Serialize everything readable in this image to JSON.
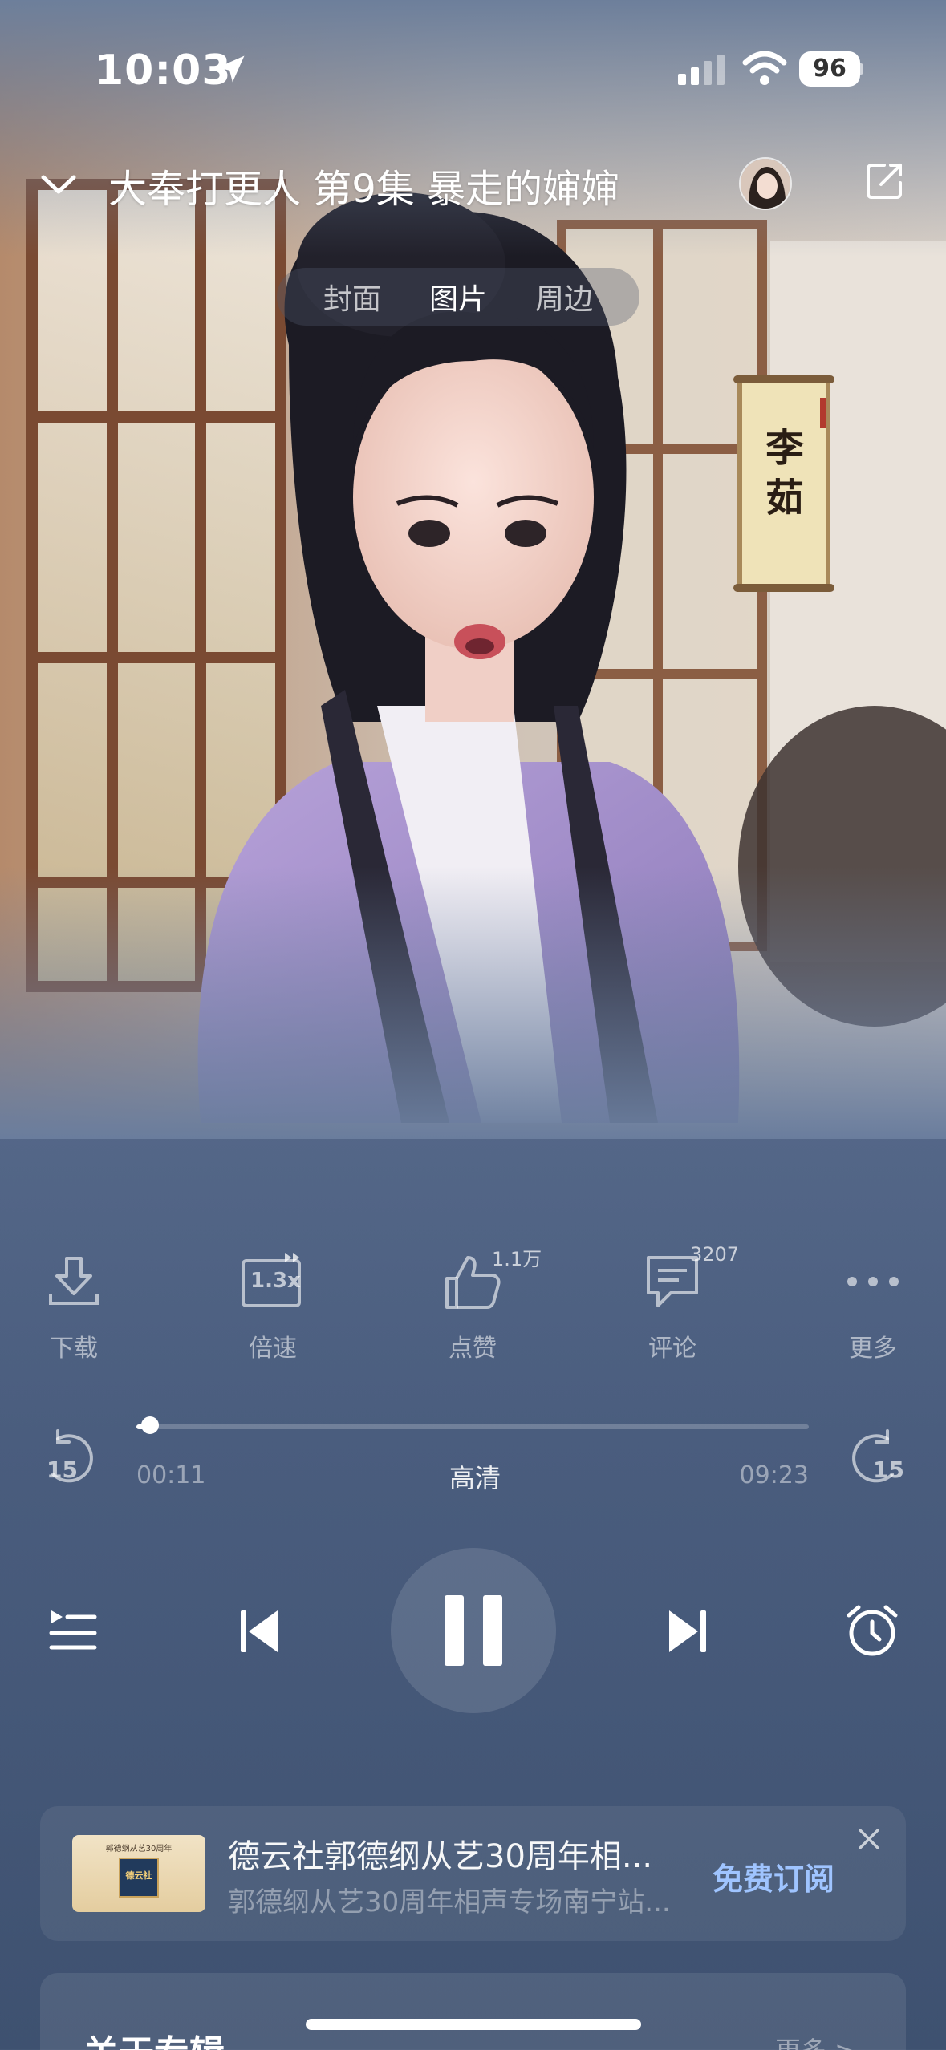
{
  "status_bar": {
    "time": "10:03",
    "battery": "96",
    "icons": [
      "location-arrow-icon",
      "signal-icon",
      "wifi-icon",
      "battery-icon"
    ]
  },
  "header": {
    "title": "大奉打更人 第9集 暴走的婶婶",
    "icons": [
      "chevron-down-icon",
      "avatar",
      "share-icon"
    ]
  },
  "tabs": [
    {
      "label": "封面",
      "active": false
    },
    {
      "label": "图片",
      "active": true
    },
    {
      "label": "周边",
      "active": false
    }
  ],
  "artwork": {
    "scroll_text": "李茹"
  },
  "actions": [
    {
      "label": "下载",
      "icon": "download-icon",
      "badge": ""
    },
    {
      "label": "倍速",
      "icon": "speed-icon",
      "speed": "1.3x",
      "badge": ""
    },
    {
      "label": "点赞",
      "icon": "thumbs-up-icon",
      "badge": "1.1万"
    },
    {
      "label": "评论",
      "icon": "comment-icon",
      "badge": "3207"
    },
    {
      "label": "更多",
      "icon": "more-dots-icon",
      "badge": ""
    }
  ],
  "player": {
    "elapsed": "00:11",
    "duration": "09:23",
    "progress": 0.02,
    "quality": "高清",
    "rewind_label": "15",
    "forward_label": "15",
    "state": "playing"
  },
  "ad": {
    "title": "德云社郭德纲从艺30周年相...",
    "subtitle": "郭德纲从艺30周年相声专场南宁站...",
    "cta": "免费订阅",
    "thumb_caption": "德云社",
    "thumb_top": "郭德纲从艺30周年"
  },
  "about": {
    "title": "关于专辑",
    "more": "更多 >"
  },
  "colors": {
    "accent": "#9fc4ff",
    "background": "#4a5d7e"
  }
}
